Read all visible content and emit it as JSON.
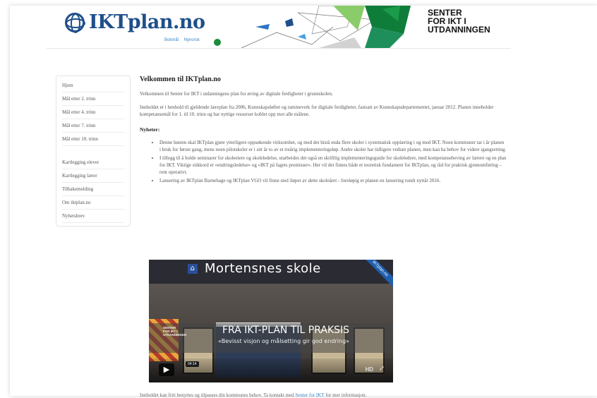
{
  "header": {
    "logo_text": "IKTplan.no",
    "logo_links": [
      "Bokmål",
      "Nynorsk"
    ],
    "partner_line1": "SENTER",
    "partner_line2": "FOR IKT I",
    "partner_line3": "UTDANNINGEN"
  },
  "sidebar": {
    "group1": [
      "Hjem",
      "Mål etter 2. trinn",
      "Mål etter 4. trinn",
      "Mål etter 7. trinn",
      "Mål etter 10. trinn"
    ],
    "group2": [
      "Kartlegging elever",
      "Kartlegging lærer",
      "Tilbakemelding",
      "Om iktplan.no",
      "Nyhetsbrev"
    ]
  },
  "main": {
    "title": "Velkommen til IKTplan.no",
    "intro": "Velkommen til Senter for IKT i utdanningens plan for øving av digitale ferdigheter i grunnskolen.",
    "paragraph": "Innholdet er i henhold til gjeldende læreplan fra 2006, Kunnskapsløftet og rammeverk for digitale ferdigheter, fastsatt av Kunnskapsdepartementet, januar 2012. Planen inneholder kompetansemål for 1. til 10. trinn og har nyttige ressurser koblet opp mot alle målene.",
    "news_heading": "Nyheter:",
    "news": [
      "Denne høsten skal IKTplan gjøre ytterligere oppsøkende virksomhet, og med det bistå enda flere skoler i systematisk opplæring i og med IKT. Noen kommuner tar i år planen i bruk for første gang, mens noen pilotskoler er i sitt år to av et treårig implementeringsløp. Andre skoler har tidligere vedtatt planen, men kan ha behov for videre igangsetting.",
      "I tillegg til å holde seminarer for skoleeiere og skoleledelse, utarbeides det også en skriftlig implementeringsguide for skoleledere, med kompetanseheving av lærere og en plan for IKT. Viktige stikkord er «endringsledelse» og «IKT på fagets premisser». Her vil det finnes både et teoretisk fundament for IKTplan, og råd for praktisk gjennomføring – rent operativt.",
      "Lansering av IKTplan Barnehage og IKTplan VGO vil finne sted iløpet av dette skoleåret - foreløpig er planen en lansering rundt nyttår 2016."
    ],
    "footer_prefix": "Innholdet kan fritt benyttes og tilpasses din kommunes behov. Ta kontakt med ",
    "footer_link": "Senter for IKT",
    "footer_suffix": " for mer informasjon."
  },
  "video": {
    "sign_text": "Mortensnes skole",
    "ribbon": "IKTplan.no",
    "overlay_title": "FRA IKT-PLAN TIL PRAKSIS",
    "overlay_subtitle": "«Bevisst visjon og målsetting gir god endring»",
    "senter_line1": "SENTER",
    "senter_line2": "FOR IKT I",
    "senter_line3": "UTDANNINGEN",
    "time": "04:14",
    "hd": "HD",
    "play_icon": "play-icon",
    "fullscreen_icon": "fullscreen-icon"
  },
  "colors": {
    "brand": "#1f4f8b",
    "link": "#3b82c4"
  }
}
